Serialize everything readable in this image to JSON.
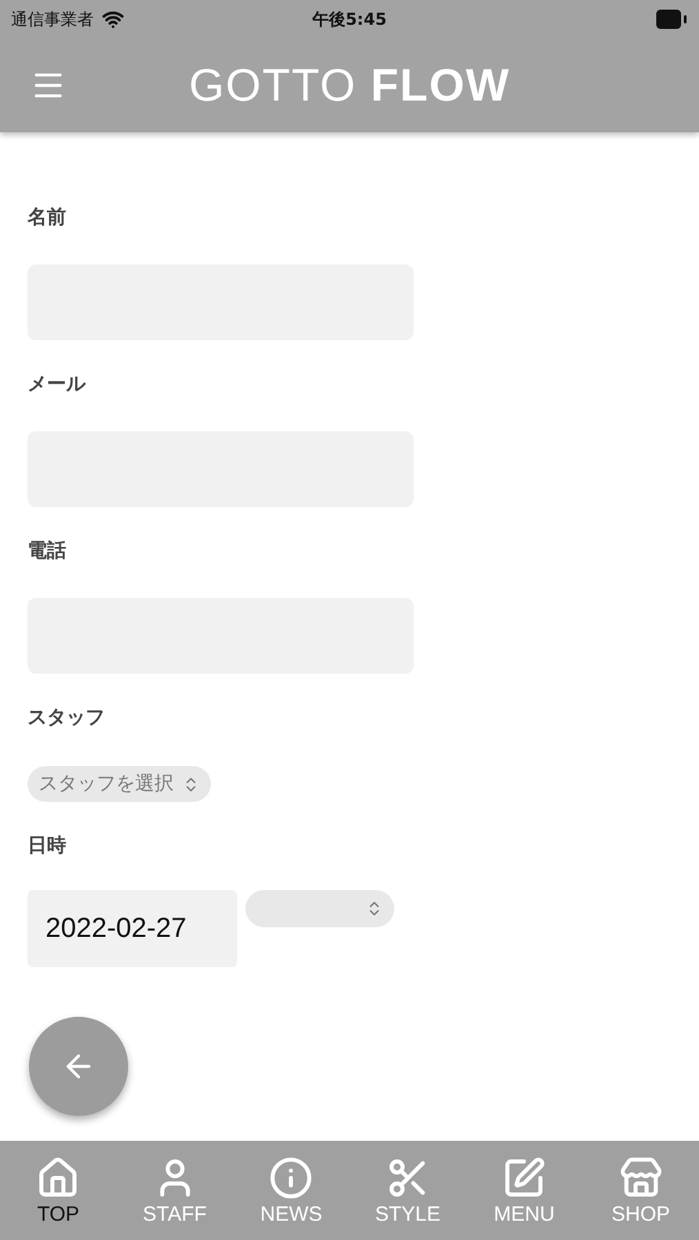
{
  "status_bar": {
    "carrier": "通信事業者",
    "time": "午後5:45"
  },
  "header": {
    "logo": "GOTTO **FLOW**"
  },
  "form": [
    {
      "kind": "text",
      "label": "名前"
    },
    {
      "kind": "text",
      "label": "メール"
    },
    {
      "kind": "text",
      "label": "電話"
    },
    {
      "kind": "select",
      "label": "スタッフ",
      "value": "スタッフを選択"
    },
    {
      "kind": "datetime",
      "label": "日時",
      "value": "2022-02-27"
    }
  ],
  "tab_bar": [
    {
      "label": "TOP",
      "kind": "home",
      "selected": true
    },
    {
      "label": "STAFF",
      "kind": "user",
      "selected": false
    },
    {
      "label": "NEWS",
      "kind": "info",
      "selected": false
    },
    {
      "label": "STYLE",
      "kind": "scissors",
      "selected": false
    },
    {
      "label": "MENU",
      "kind": "edit",
      "selected": false
    },
    {
      "label": "SHOP",
      "kind": "store",
      "selected": false
    }
  ]
}
